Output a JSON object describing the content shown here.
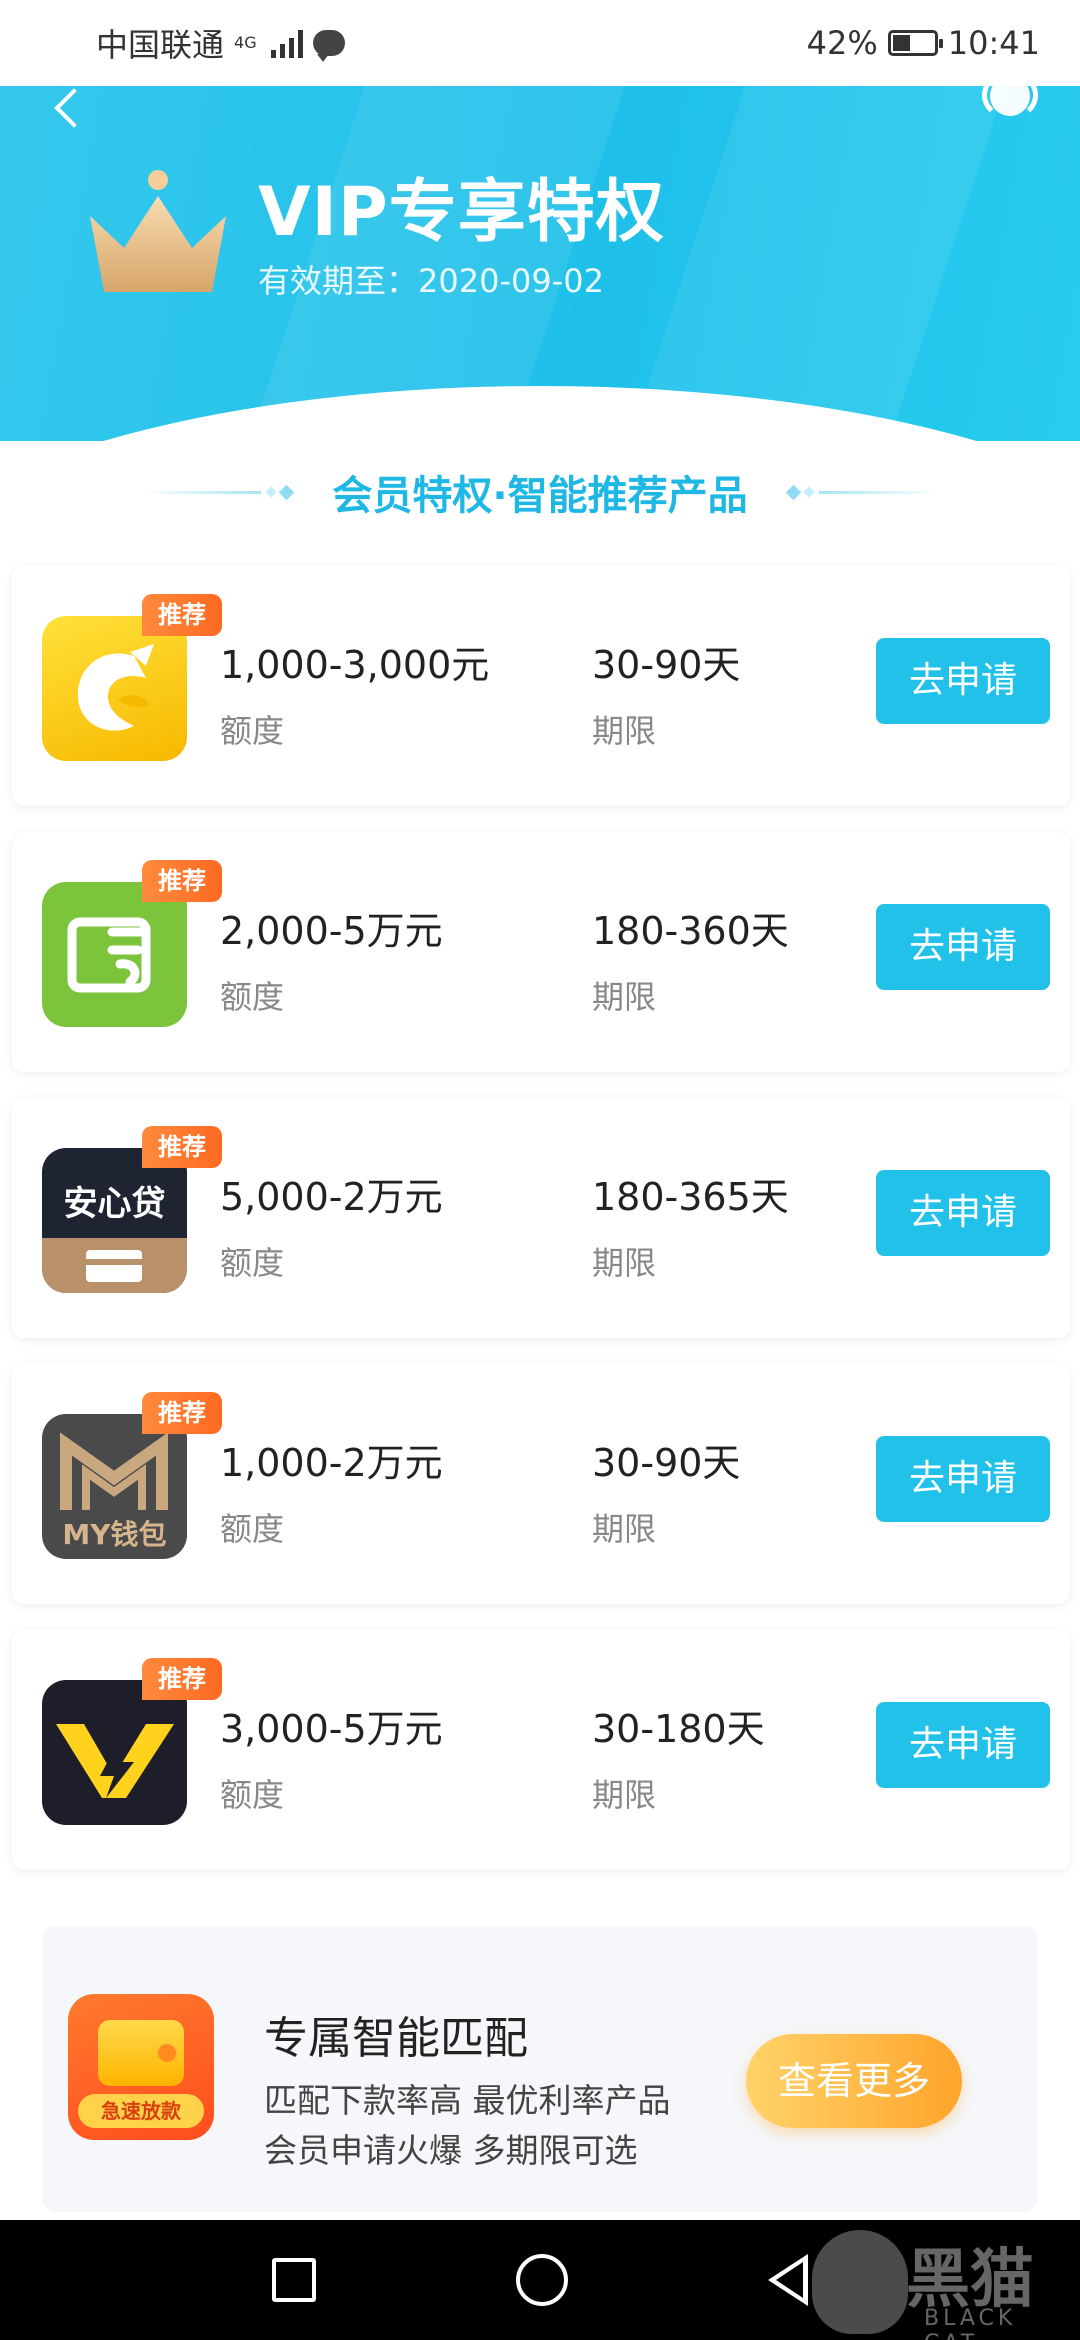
{
  "status_bar": {
    "carrier": "中国联通",
    "network": "4G",
    "battery": "42%",
    "battery_level": 0.42,
    "time": "10:41"
  },
  "header": {
    "title": "VIP专享特权",
    "validity": "有效期至：2020-09-02"
  },
  "section": {
    "title": "会员特权·智能推荐产品"
  },
  "products": [
    {
      "badge": "推荐",
      "amount": "1,000-3,000元",
      "amount_label": "额度",
      "term": "30-90天",
      "term_label": "期限",
      "button": "去申请",
      "logo": "dragon-app-icon"
    },
    {
      "badge": "推荐",
      "amount": "2,000-5万元",
      "amount_label": "额度",
      "term": "180-360天",
      "term_label": "期限",
      "button": "去申请",
      "logo": "green-card-app-icon"
    },
    {
      "badge": "推荐",
      "amount": "5,000-2万元",
      "amount_label": "额度",
      "term": "180-365天",
      "term_label": "期限",
      "button": "去申请",
      "logo": "anxindai-app-icon",
      "logo_text": "安心贷"
    },
    {
      "badge": "推荐",
      "amount": "1,000-2万元",
      "amount_label": "额度",
      "term": "30-90天",
      "term_label": "期限",
      "button": "去申请",
      "logo": "my-wallet-app-icon",
      "logo_text": "MY钱包"
    },
    {
      "badge": "推荐",
      "amount": "3,000-5万元",
      "amount_label": "额度",
      "term": "30-180天",
      "term_label": "期限",
      "button": "去申请",
      "logo": "v-lightning-app-icon"
    }
  ],
  "match": {
    "title": "专属智能匹配",
    "line1": "匹配下款率高 最优利率产品",
    "line2": "会员申请火爆 多期限可选",
    "button": "查看更多",
    "logo_tag": "急速放款"
  },
  "watermark": {
    "text": "黑猫",
    "sub": "BLACK CAT"
  },
  "colors": {
    "header": "#1ec0ea",
    "accent": "#22c1ea",
    "badge": "#ff7a2e",
    "more_button": "#ffa42b"
  }
}
